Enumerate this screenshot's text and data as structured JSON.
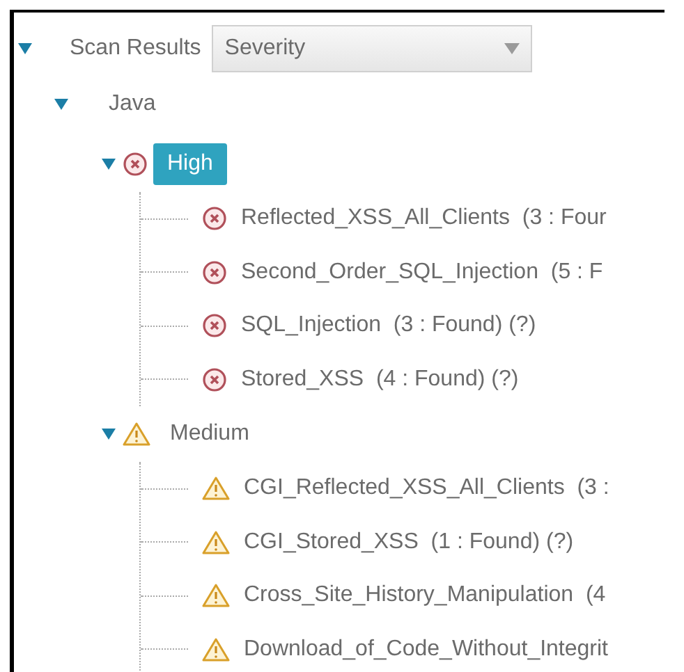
{
  "tree": {
    "label": "Scan Results",
    "expanded": true,
    "group_by": {
      "value": "Severity"
    },
    "children": [
      {
        "label": "Java",
        "expanded": true,
        "children": [
          {
            "label": "High",
            "kind": "error",
            "expanded": true,
            "selected": true,
            "children": [
              {
                "label": "Reflected_XSS_All_Clients  (3 : Four",
                "kind": "error"
              },
              {
                "label": "Second_Order_SQL_Injection  (5 : F",
                "kind": "error"
              },
              {
                "label": "SQL_Injection  (3 : Found) (?)",
                "kind": "error"
              },
              {
                "label": "Stored_XSS  (4 : Found) (?)",
                "kind": "error"
              }
            ]
          },
          {
            "label": "Medium",
            "kind": "warning",
            "expanded": true,
            "selected": false,
            "children": [
              {
                "label": "CGI_Reflected_XSS_All_Clients  (3 :",
                "kind": "warning"
              },
              {
                "label": "CGI_Stored_XSS  (1 : Found) (?)",
                "kind": "warning"
              },
              {
                "label": "Cross_Site_History_Manipulation  (4",
                "kind": "warning"
              },
              {
                "label": "Download_of_Code_Without_Integrit",
                "kind": "warning"
              }
            ]
          }
        ]
      }
    ]
  }
}
